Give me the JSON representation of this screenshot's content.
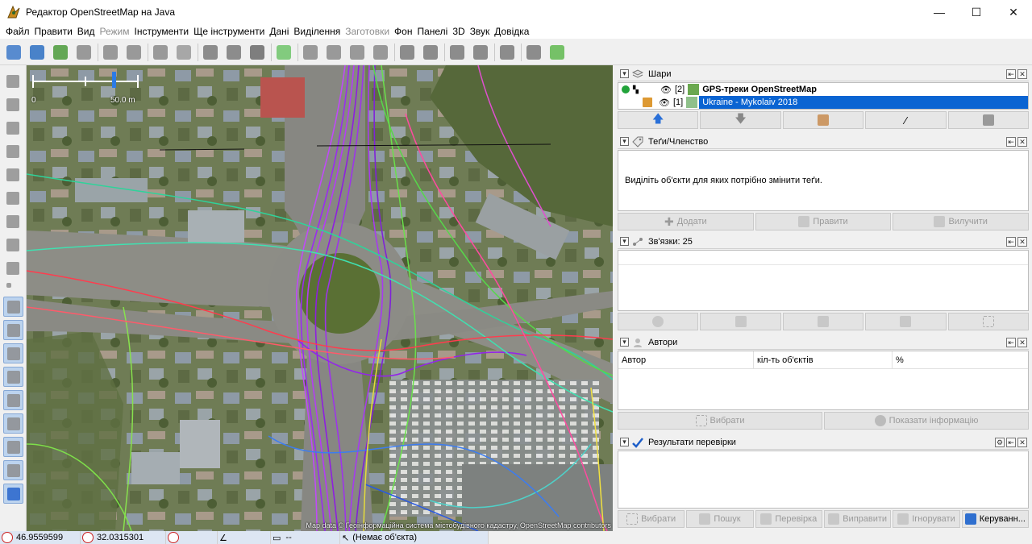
{
  "window": {
    "title": "Редактор OpenStreetMap на Java",
    "minimize": "—",
    "maximize": "☐",
    "close": "✕"
  },
  "menu": [
    {
      "label": "Файл",
      "disabled": false
    },
    {
      "label": "Правити",
      "disabled": false
    },
    {
      "label": "Вид",
      "disabled": false
    },
    {
      "label": "Режим",
      "disabled": true
    },
    {
      "label": "Інструменти",
      "disabled": false
    },
    {
      "label": "Ще інструменти",
      "disabled": false
    },
    {
      "label": "Дані",
      "disabled": false
    },
    {
      "label": "Виділення",
      "disabled": false
    },
    {
      "label": "Заготовки",
      "disabled": true
    },
    {
      "label": "Фон",
      "disabled": false
    },
    {
      "label": "Панелі",
      "disabled": false
    },
    {
      "label": "3D",
      "disabled": false
    },
    {
      "label": "Звук",
      "disabled": false
    },
    {
      "label": "Довідка",
      "disabled": false
    }
  ],
  "map": {
    "scale_zero": "0",
    "scale_value": "50.0 m",
    "attribution": "Map data © Геоінформаційна система містобудівного кадастру, OpenStreetMap contributors"
  },
  "layers_panel": {
    "title": "Шари",
    "layers": [
      {
        "index": "[2]",
        "name": "GPS-треки OpenStreetMap",
        "bold": true,
        "selected": false
      },
      {
        "index": "[1]",
        "name": "Ukraine - Mykolaiv 2018",
        "bold": false,
        "selected": true
      }
    ]
  },
  "tags_panel": {
    "title": "Теґи/Членство",
    "message": "Виділіть об'єкти для яких потрібно змінити теґи.",
    "add": "Додати",
    "edit": "Правити",
    "delete": "Вилучити"
  },
  "relations_panel": {
    "title": "Зв'язки: 25"
  },
  "authors_panel": {
    "title": "Автори",
    "col_author": "Автор",
    "col_count": "кіл-ть об'єктів",
    "col_percent": "%",
    "select": "Вибрати",
    "show_info": "Показати інформацію"
  },
  "validation_panel": {
    "title": "Результати перевірки",
    "select": "Вибрати",
    "search": "Пошук",
    "check": "Перевірка",
    "fix": "Виправити",
    "ignore": "Ігнорувати",
    "manage": "Керуванн..."
  },
  "status": {
    "lat": "46.9559599",
    "lon": "32.0315301",
    "heading": "",
    "angle": "",
    "distance": "--",
    "selection": "(Немає об'єкта)"
  }
}
